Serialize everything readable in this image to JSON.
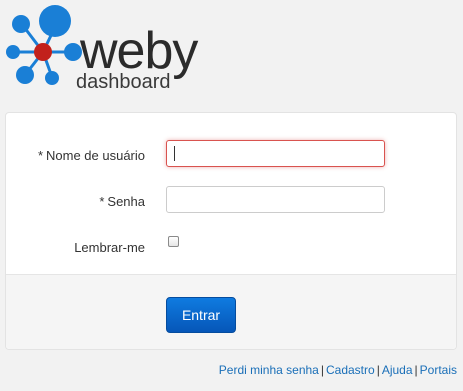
{
  "brand": {
    "name": "weby",
    "subtitle": "dashboard",
    "colors": {
      "blue": "#1a7fd6",
      "red": "#c2211c",
      "dark": "#2b2b2b"
    }
  },
  "form": {
    "username": {
      "required_mark": "*",
      "label": "Nome de usuário",
      "value": ""
    },
    "password": {
      "required_mark": "*",
      "label": "Senha",
      "value": ""
    },
    "remember": {
      "label": "Lembrar-me",
      "checked": false
    },
    "submit_label": "Entrar"
  },
  "footer": {
    "links": [
      "Perdi minha senha",
      "Cadastro",
      "Ajuda",
      "Portais"
    ],
    "separator": "|"
  }
}
